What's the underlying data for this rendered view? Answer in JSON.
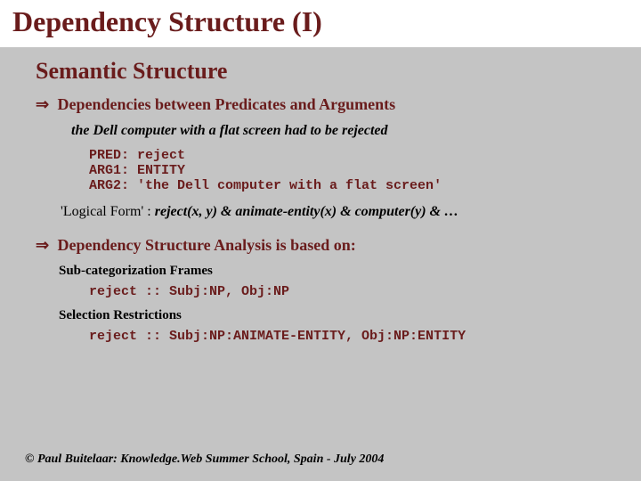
{
  "title": "Dependency Structure (I)",
  "subtitle": "Semantic Structure",
  "point1": {
    "arrow": "⇒",
    "text": "Dependencies between Predicates and Arguments"
  },
  "example_sentence": "the Dell computer with a flat screen had to be rejected",
  "pred_block": "PRED: reject\nARG1: ENTITY\nARG2: 'the Dell computer with a flat screen'",
  "logical_form": {
    "label": "'Logical Form' : ",
    "expr": "reject(x, y) & animate-entity(x) & computer(y) & …"
  },
  "point2": {
    "arrow": "⇒",
    "text": "Dependency Structure Analysis is based on:"
  },
  "subcat": {
    "heading": "Sub-categorization Frames",
    "line": "reject :: Subj:NP, Obj:NP"
  },
  "selres": {
    "heading": "Selection Restrictions",
    "line": "reject :: Subj:NP:ANIMATE-ENTITY, Obj:NP:ENTITY"
  },
  "footer": "© Paul Buitelaar:  Knowledge.Web Summer School, Spain - July 2004"
}
